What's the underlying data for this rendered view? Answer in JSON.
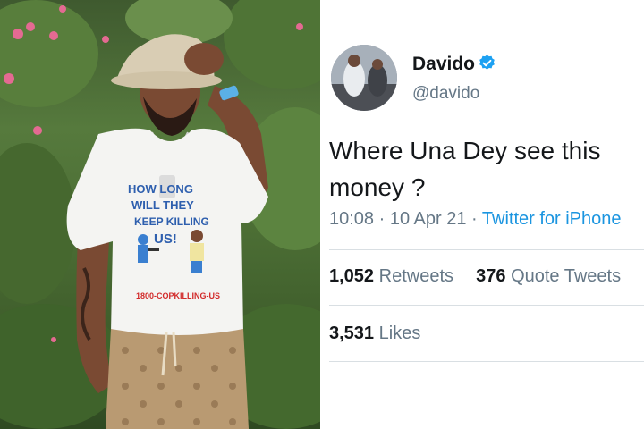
{
  "tweet": {
    "display_name": "Davido",
    "handle": "@davido",
    "verified": true,
    "text": "Where Una Dey see this money ?",
    "time": "10:08",
    "date": "10 Apr 21",
    "source": "Twitter for iPhone",
    "retweets_count": "1,052",
    "retweets_label": "Retweets",
    "quotes_count": "376",
    "quotes_label": "Quote Tweets",
    "likes_count": "3,531",
    "likes_label": "Likes"
  },
  "photo": {
    "shirt_text_lines": [
      "HOW LONG",
      "WILL THEY",
      "KEEP KILLING",
      "US!"
    ],
    "shirt_footer": "1800-COPKILLING-US"
  },
  "colors": {
    "verified_blue": "#1da1f2",
    "link_blue": "#1b95e0",
    "secondary_text": "#657786",
    "primary_text": "#14171a"
  }
}
